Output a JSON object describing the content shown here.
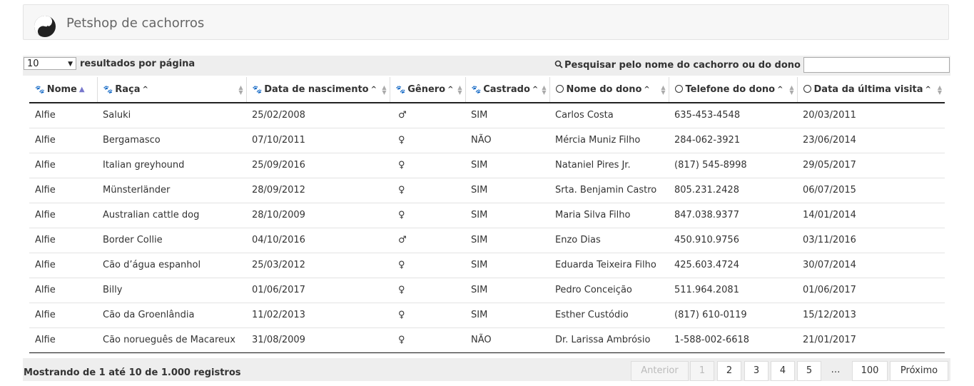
{
  "app": {
    "title": "Petshop de cachorros",
    "logo_icon": "yin-yang-paw-icon"
  },
  "controls": {
    "page_length_value": "10",
    "page_length_label": "resultados por página",
    "search_label": "Pesquisar pelo nome do cachorro ou do dono",
    "search_value": ""
  },
  "table": {
    "headers": [
      {
        "label": "Nome",
        "icon": "paw-icon"
      },
      {
        "label": "Raça",
        "icon": "paw-icon"
      },
      {
        "label": "Data de nascimento",
        "icon": "paw-icon"
      },
      {
        "label": "Gênero",
        "icon": "paw-icon"
      },
      {
        "label": "Castrado",
        "icon": "paw-icon"
      },
      {
        "label": "Nome do dono",
        "icon": "user-icon"
      },
      {
        "label": "Telefone do dono",
        "icon": "user-icon"
      },
      {
        "label": "Data da última visita",
        "icon": "user-icon"
      }
    ],
    "rows": [
      [
        "Alfie",
        "Saluki",
        "25/02/2008",
        "♂",
        "SIM",
        "Carlos Costa",
        "635-453-4548",
        "20/03/2011"
      ],
      [
        "Alfie",
        "Bergamasco",
        "07/10/2011",
        "♀",
        "NÃO",
        "Mércia Muniz Filho",
        "284-062-3921",
        "23/06/2014"
      ],
      [
        "Alfie",
        "Italian greyhound",
        "25/09/2016",
        "♀",
        "SIM",
        "Nataniel Pires Jr.",
        "(817) 545-8998",
        "29/05/2017"
      ],
      [
        "Alfie",
        "Münsterländer",
        "28/09/2012",
        "♀",
        "SIM",
        "Srta. Benjamin Castro",
        "805.231.2428",
        "06/07/2015"
      ],
      [
        "Alfie",
        "Australian cattle dog",
        "28/10/2009",
        "♀",
        "SIM",
        "Maria Silva Filho",
        "847.038.9377",
        "14/01/2014"
      ],
      [
        "Alfie",
        "Border Collie",
        "04/10/2016",
        "♂",
        "SIM",
        "Enzo Dias",
        "450.910.9756",
        "03/11/2016"
      ],
      [
        "Alfie",
        "Cão d’água espanhol",
        "25/03/2012",
        "♀",
        "SIM",
        "Eduarda Teixeira Filho",
        "425.603.4724",
        "30/07/2014"
      ],
      [
        "Alfie",
        "Billy",
        "01/06/2017",
        "♀",
        "SIM",
        "Pedro Conceição",
        "511.964.2081",
        "01/06/2017"
      ],
      [
        "Alfie",
        "Cão da Groenlândia",
        "11/02/2013",
        "♀",
        "SIM",
        "Esther Custódio",
        "(817) 610-0119",
        "15/12/2013"
      ],
      [
        "Alfie",
        "Cão norueguês de Macareux",
        "31/08/2009",
        "♀",
        "NÃO",
        "Dr. Larissa Ambrósio",
        "1-588-002-6618",
        "21/01/2017"
      ]
    ]
  },
  "footer": {
    "info": "Mostrando de 1 até 10 de 1.000 registros",
    "prev": "Anterior",
    "pages": [
      "1",
      "2",
      "3",
      "4",
      "5"
    ],
    "ellipsis": "…",
    "last_page": "100",
    "next": "Próximo"
  }
}
